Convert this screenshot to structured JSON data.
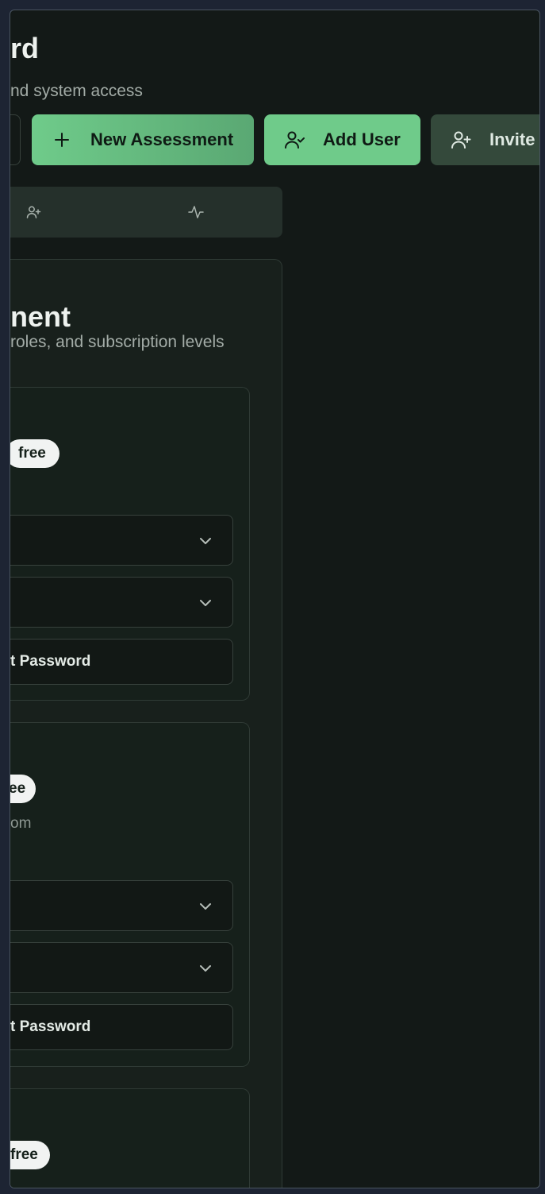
{
  "header": {
    "title_fragment": "rd",
    "subtitle_fragment": "nd system access"
  },
  "actions": {
    "new_assessment": "New Assessment",
    "add_user": "Add User",
    "invite": "Invite"
  },
  "tabs": [
    {
      "icon": "user-plus-icon"
    },
    {
      "icon": "activity-icon"
    }
  ],
  "panel": {
    "title_fragment": "nent",
    "description_fragment": "roles, and subscription levels"
  },
  "users": [
    {
      "badge": "free",
      "email_fragment": "",
      "reset_label": "t Password"
    },
    {
      "badge": "ee",
      "email_fragment": "om",
      "reset_label": "t Password"
    },
    {
      "badge": "free"
    }
  ],
  "colors": {
    "background": "#131917",
    "accent": "#6fcb8a",
    "invite_button": "#34493b",
    "card": "#16201b"
  }
}
